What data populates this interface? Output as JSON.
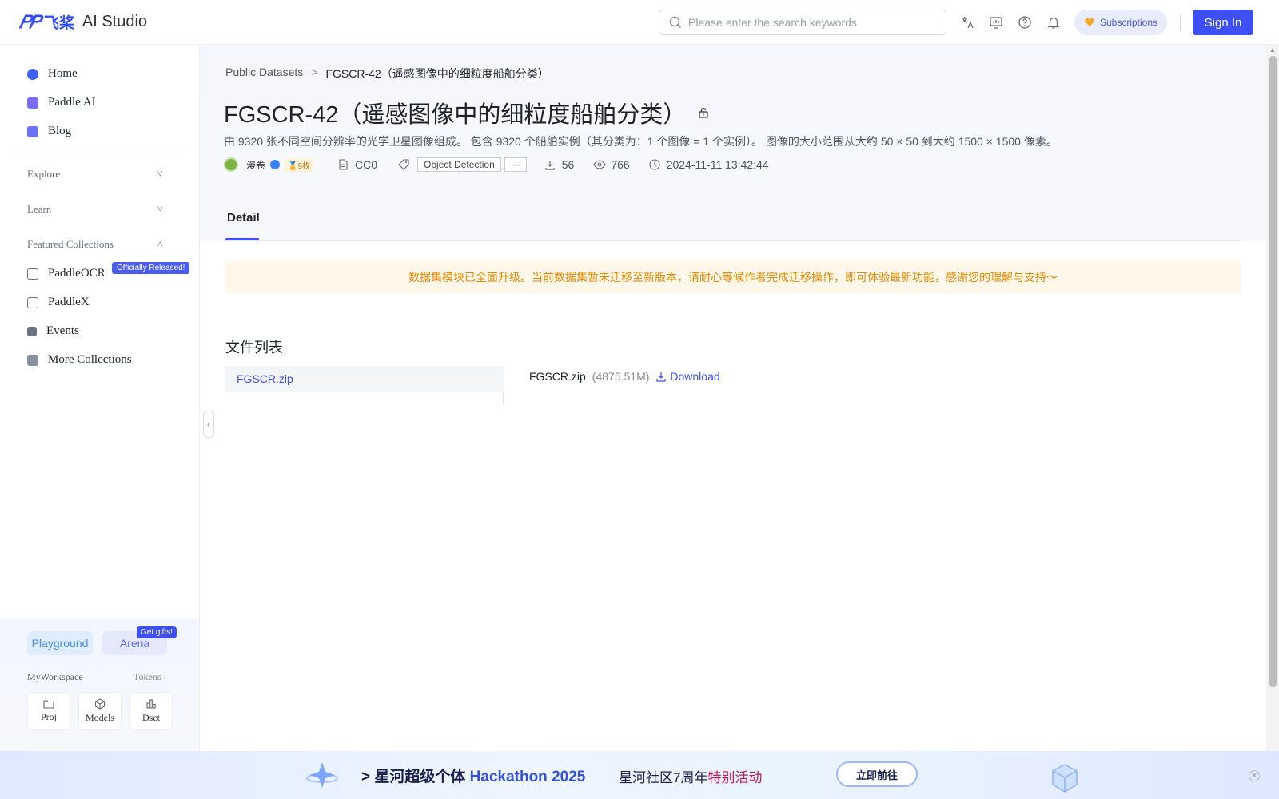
{
  "header": {
    "logo_mark": "𝑃𝑃",
    "logo_cn": "飞桨",
    "logo_text": "AI Studio",
    "search_placeholder": "Please enter the search keywords",
    "subscriptions_label": "Subscriptions",
    "signin_label": "Sign In"
  },
  "sidebar": {
    "items": [
      {
        "label": "Home",
        "color": "#3d62f5"
      },
      {
        "label": "Paddle AI",
        "color": "#7a6cf5"
      },
      {
        "label": "Blog",
        "color": "#6b72f5"
      }
    ],
    "sections": [
      {
        "label": "Explore",
        "chevron": "˅"
      },
      {
        "label": "Learn",
        "chevron": "˅"
      },
      {
        "label": "Featured Collections",
        "chevron": "˄"
      }
    ],
    "collections": [
      {
        "label": "PaddleOCR"
      },
      {
        "label": "PaddleX"
      },
      {
        "label": "Events"
      },
      {
        "label": "More Collections"
      }
    ],
    "released_badge": "Officially Released!",
    "playground_label": "Playground",
    "arena_label": "Arena",
    "gift_badge": "Get gifts!",
    "workspace_title": "MyWorkspace",
    "tokens_label": "Tokens",
    "workspace_cards": [
      {
        "label": "Proj"
      },
      {
        "label": "Models"
      },
      {
        "label": "Dset"
      }
    ]
  },
  "breadcrumb": {
    "parent": "Public Datasets",
    "separator": ">",
    "current": "FGSCR-42（遥感图像中的细粒度船舶分类）"
  },
  "dataset": {
    "title": "FGSCR-42（遥感图像中的细粒度船舶分类）",
    "description": "由 9320 张不同空间分辨率的光学卫星图像组成。 包含 9320 个船舶实例（其分类为：1 个图像 = 1 个实例）。 图像的大小范围从大约 50 × 50 到大约 1500 × 1500 像素。",
    "author": "漫卷",
    "medal": "9枚",
    "license": "CC0",
    "tag": "Object Detection",
    "more_tags": "···",
    "downloads": "56",
    "views": "766",
    "date": "2024-11-11 13:42:44"
  },
  "tabs": {
    "detail_label": "Detail"
  },
  "notice": "数据集模块已全面升级。当前数据集暂未迁移至新版本，请耐心等候作者完成迁移操作，即可体验最新功能，感谢您的理解与支持～",
  "files": {
    "title": "文件列表",
    "list": [
      {
        "name": "FGSCR.zip"
      }
    ],
    "selected_name": "FGSCR.zip",
    "selected_size": "(4875.51M)",
    "download_label": "Download"
  },
  "banner": {
    "prefix": "> 星河超级个体 ",
    "hackathon": "Hackathon 2025",
    "text_a": "星河社区7周年",
    "text_b": "特别活动",
    "button": "立即前往"
  },
  "colors": {
    "accent": "#3d4ff5",
    "notice_text": "#e08a00",
    "notice_bg": "#fff7ea"
  }
}
